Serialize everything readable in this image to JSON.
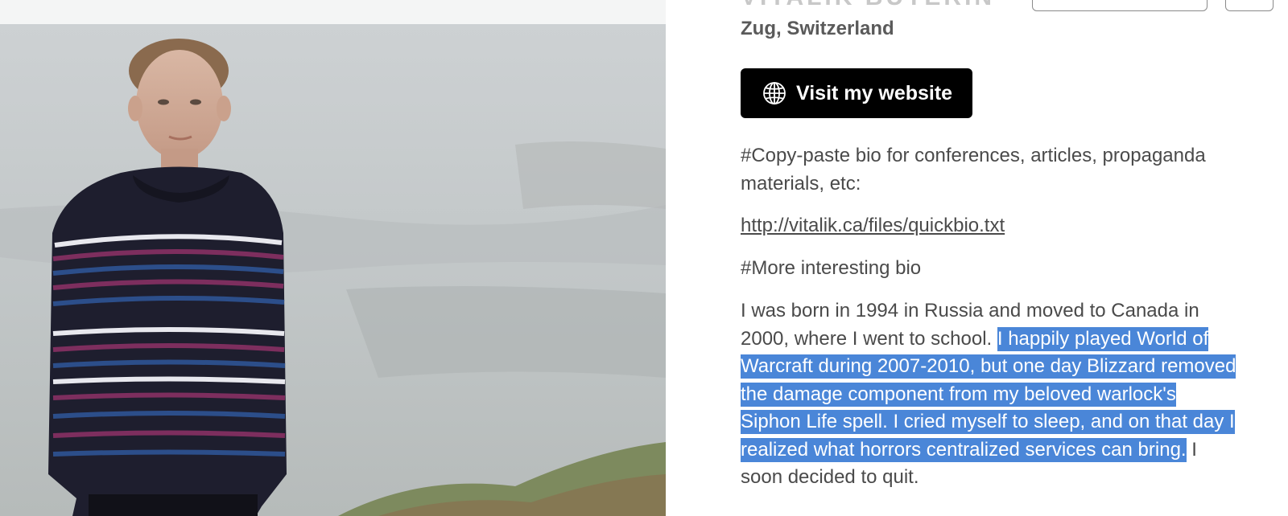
{
  "profile": {
    "name": "VITALIK BUTERIN",
    "location": "Zug, Switzerland",
    "website_button": {
      "label": "Visit my website",
      "icon": "globe-icon"
    }
  },
  "bio": {
    "copy_paste_heading": "#Copy-paste bio for conferences, articles, propaganda materials, etc:",
    "link": "http://vitalik.ca/files/quickbio.txt",
    "interesting_heading": "#More interesting bio",
    "paragraph_before_selection": "I was born in 1994 in Russia and moved to Canada in 2000, where I went to school. ",
    "paragraph_selected": "I happily played World of Warcraft during 2007-2010, but one day Blizzard removed the damage component from my beloved warlock's Siphon Life spell. I cried myself to sleep, and on that day I realized what horrors centralized services can bring.",
    "paragraph_after_selection": " I soon decided to quit."
  },
  "colors": {
    "selection": "#4a86d8",
    "button_background": "#000000",
    "body_text": "#4a4a4a"
  }
}
